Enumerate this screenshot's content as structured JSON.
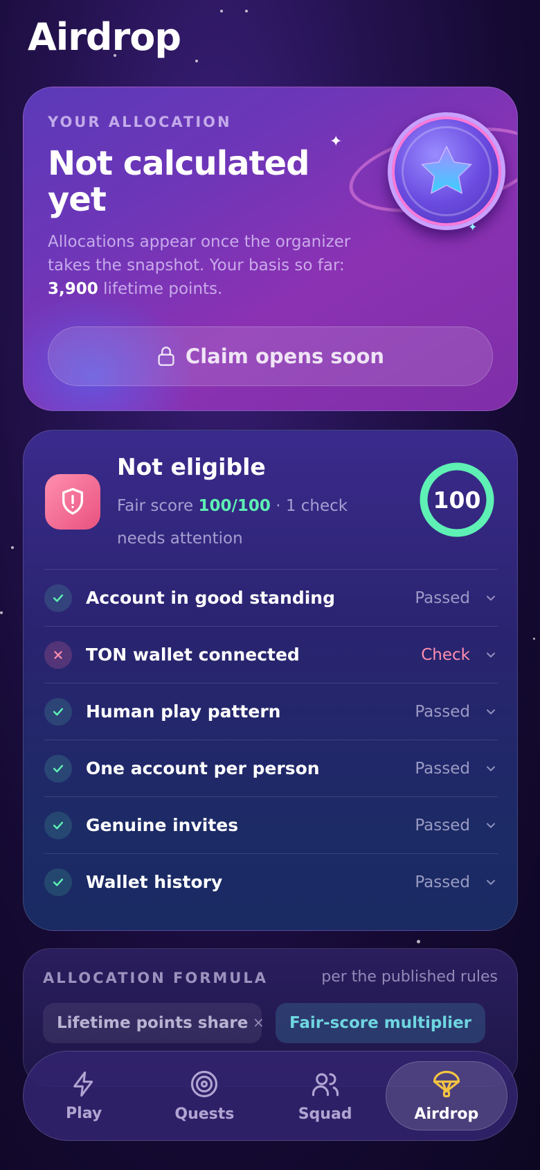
{
  "page": {
    "title": "Airdrop"
  },
  "allocation": {
    "eyebrow": "YOUR ALLOCATION",
    "heading": "Not calculated yet",
    "desc_prefix": "Allocations appear once the organizer takes the snapshot. Your basis so far: ",
    "points": "3,900",
    "desc_suffix": " lifetime points.",
    "claim_label": "Claim opens soon"
  },
  "eligibility": {
    "title": "Not eligible",
    "sub_prefix": "Fair score ",
    "score": "100/100",
    "sub_suffix": " · 1 check needs attention",
    "ring_value": "100",
    "ring_fraction": 1.0,
    "checks": [
      {
        "label": "Account in good standing",
        "status": "Passed",
        "ok": true
      },
      {
        "label": "TON wallet connected",
        "status": "Check",
        "ok": false
      },
      {
        "label": "Human play pattern",
        "status": "Passed",
        "ok": true
      },
      {
        "label": "One account per person",
        "status": "Passed",
        "ok": true
      },
      {
        "label": "Genuine invites",
        "status": "Passed",
        "ok": true
      },
      {
        "label": "Wallet history",
        "status": "Passed",
        "ok": true
      }
    ]
  },
  "formula": {
    "eyebrow": "ALLOCATION FORMULA",
    "note": "per the published rules",
    "chip_a": "Lifetime points share",
    "operator": "×",
    "chip_b": "Fair-score multiplier"
  },
  "nav": {
    "items": [
      {
        "label": "Play",
        "icon": "bolt-icon"
      },
      {
        "label": "Quests",
        "icon": "target-icon"
      },
      {
        "label": "Squad",
        "icon": "users-icon"
      },
      {
        "label": "Airdrop",
        "icon": "parachute-icon",
        "active": true
      }
    ]
  },
  "colors": {
    "accent_green": "#5ef0b4",
    "warn_pink": "#ff8fb0",
    "active_nav": "#f5c542"
  }
}
